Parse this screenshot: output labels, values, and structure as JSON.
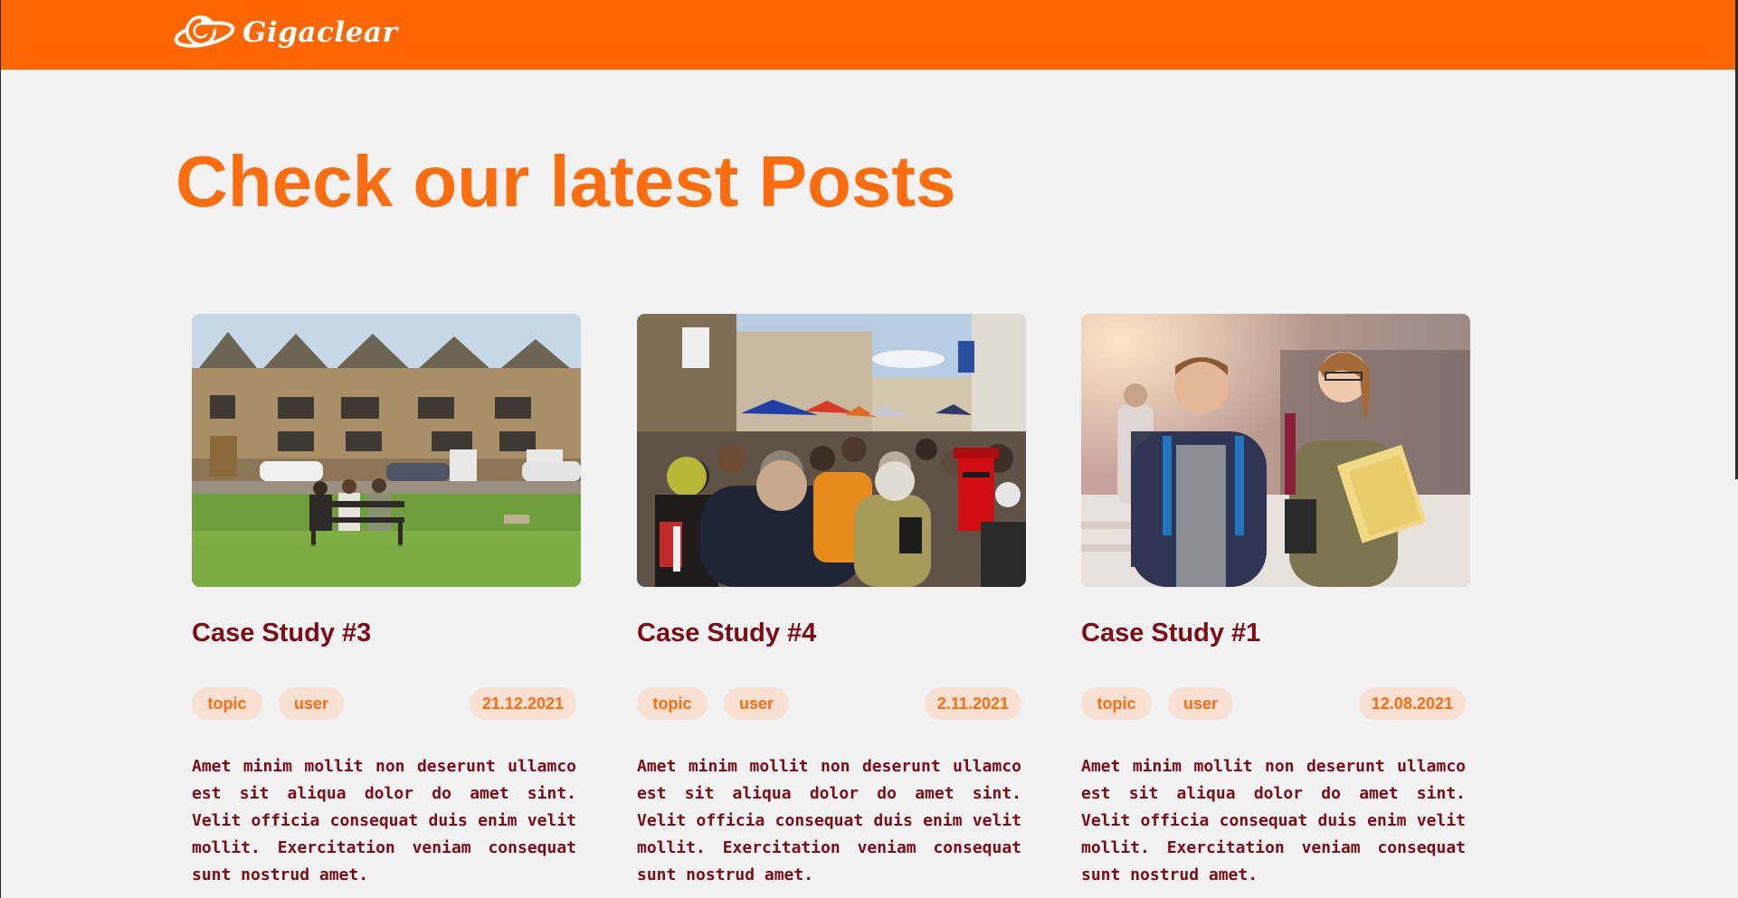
{
  "header": {
    "brand": "Gigaclear",
    "logo_icon": "gigaclear-g-logo-icon",
    "background_color": "#ff6600"
  },
  "main": {
    "heading": "Check our latest Posts"
  },
  "posts": [
    {
      "title": "Case Study #3",
      "tags": [
        "topic",
        "user"
      ],
      "date": "21.12.2021",
      "excerpt": "Amet minim mollit non deserunt ullamco est sit aliqua dolor do amet sint. Velit officia consequat duis enim velit mollit. Exercitation veniam consequat sunt nostrud amet.",
      "image": "photo of stone building and bench on green lawn"
    },
    {
      "title": "Case Study #4",
      "tags": [
        "topic",
        "user"
      ],
      "date": "2.11.2021",
      "excerpt": "Amet minim mollit non deserunt ullamco est sit aliqua dolor do amet sint. Velit officia consequat duis enim velit mollit. Exercitation veniam consequat sunt nostrud amet.",
      "image": "photo of crowded street market with red post box"
    },
    {
      "title": "Case Study #1",
      "tags": [
        "topic",
        "user"
      ],
      "date": "12.08.2021",
      "excerpt": "Amet minim mollit non deserunt ullamco est sit aliqua dolor do amet sint. Velit officia consequat duis enim velit mollit. Exercitation veniam consequat sunt nostrud amet.",
      "image": "photo of two students with backpacks"
    }
  ],
  "colors": {
    "accent": "#ff6d0e",
    "title": "#7d0c14",
    "tag_background": "#f8e0d2",
    "page_background": "#f2f2f2"
  }
}
